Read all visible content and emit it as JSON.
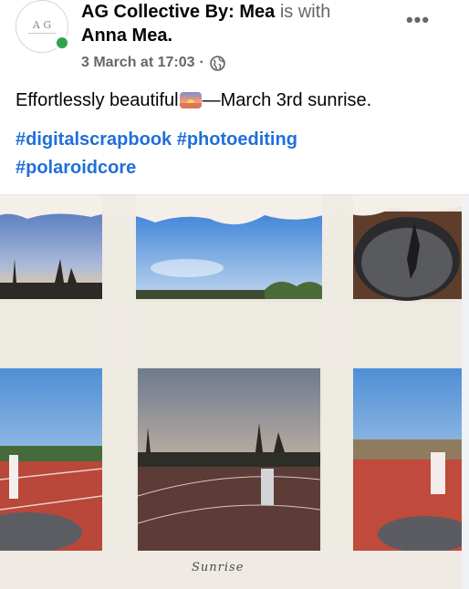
{
  "post": {
    "author": "AG Collective By: Mea",
    "with_text": "is with",
    "tagged": "Anna Mea",
    "tagged_suffix": ".",
    "date": "3 March at 17:03",
    "separator": "·",
    "audience_icon": "globe-icon",
    "more_label": "•••",
    "text_before": "Effortlessly beautiful",
    "emoji": "sunrise-emoji",
    "text_after": "—March 3rd sunrise.",
    "hashtags": [
      "#digitalscrapbook",
      "#photoediting",
      "#polaroidcore"
    ]
  },
  "avatar": {
    "monogram": "A G"
  },
  "collage": {
    "caption": "Sunrise"
  },
  "colors": {
    "link": "#216fdb",
    "online": "#31a24c",
    "muted": "#65676b",
    "paper": "#e9e4dc"
  }
}
